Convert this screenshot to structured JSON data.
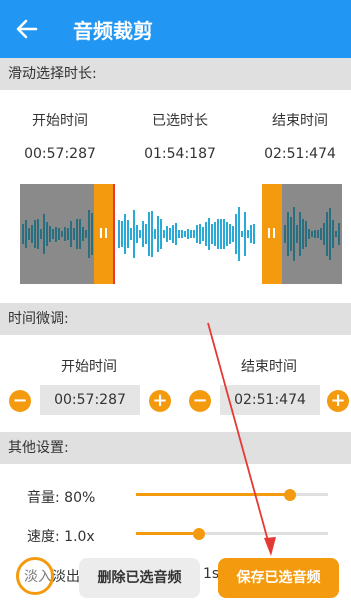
{
  "header": {
    "title": "音频裁剪",
    "color": "#2196f3"
  },
  "slide_section": {
    "title": "滑动选择时长:",
    "start_label": "开始时间",
    "start_value": "00:57:287",
    "selected_label": "已选时长",
    "selected_value": "01:54:187",
    "end_label": "结束时间",
    "end_value": "02:51:474"
  },
  "fine_section": {
    "title": "时间微调:",
    "start_label": "开始时间",
    "start_value": "00:57:287",
    "end_label": "结束时间",
    "end_value": "02:51:474"
  },
  "other_section": {
    "title": "其他设置:",
    "volume_label": "音量: 80%",
    "volume_fraction": 0.8,
    "speed_label": "速度: 1.0x",
    "speed_fraction": 0.33,
    "fade_label": "淡入淡出",
    "fade_value": "1s"
  },
  "actions": {
    "delete_label": "删除已选音频",
    "save_label": "保存已选音频"
  },
  "colors": {
    "accent": "#f39a0e",
    "wave_outer": "#2a6f80",
    "wave_inner": "#29a9d6"
  }
}
